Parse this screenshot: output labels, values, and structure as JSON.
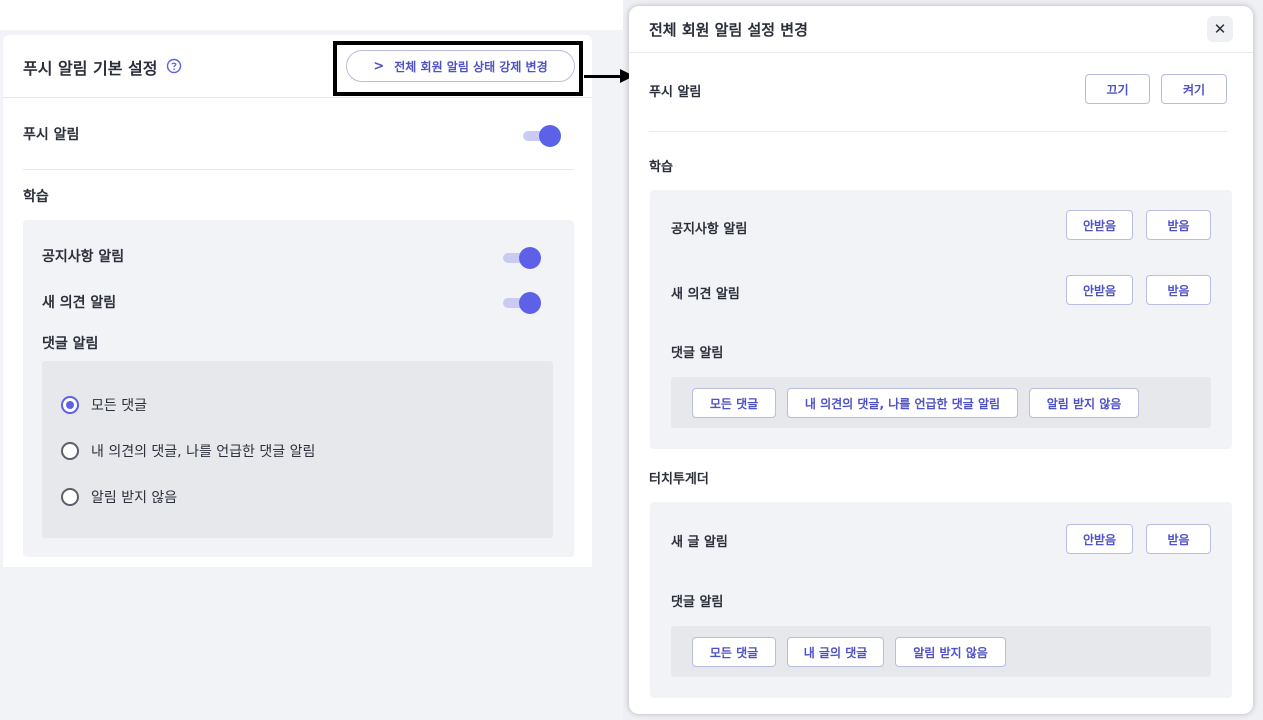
{
  "left": {
    "title": "푸시 알림 기본 설정",
    "force_button": "전체 회원 알림 상태 강제 변경",
    "push_label": "푸시 알림",
    "study_section": "학습",
    "notice_label": "공지사항 알림",
    "opinion_label": "새 의견 알림",
    "comment_label": "댓글 알림",
    "radio_options": [
      "모든 댓글",
      "내 의견의 댓글, 나를 언급한 댓글 알림",
      "알림 받지 않음"
    ],
    "selected_option": "모든 댓글",
    "toggles": {
      "push": true,
      "notice": true,
      "opinion": true
    }
  },
  "modal": {
    "title": "전체 회원 알림 설정 변경",
    "push_label": "푸시 알림",
    "off_button": "끄기",
    "on_button": "켜기",
    "study_section": "학습",
    "notice_label": "공지사항 알림",
    "opinion_label": "새 의견 알림",
    "comment_label": "댓글 알림",
    "reject_button": "안받음",
    "accept_button": "받음",
    "study_comment_chips": [
      "모든 댓글",
      "내 의견의 댓글, 나를 언급한 댓글 알림",
      "알림 받지 않음"
    ],
    "touch_section": "터치투게더",
    "new_post_label": "새 글 알림",
    "touch_comment_label": "댓글 알림",
    "touch_comment_chips": [
      "모든 댓글",
      "내 글의 댓글",
      "알림 받지 않음"
    ]
  },
  "colors": {
    "accent": "#5d61e8",
    "button_text": "#4f52c7",
    "panel_bg": "#f1f3f6"
  }
}
